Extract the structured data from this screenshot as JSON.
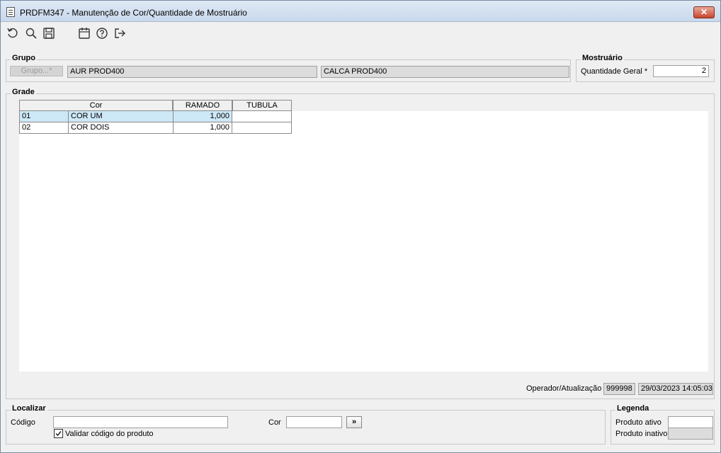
{
  "window": {
    "title": "PRDFM347 - Manutenção de Cor/Quantidade de Mostruário",
    "close_label": "✕"
  },
  "toolbar": {
    "icons": [
      "undo-icon",
      "search-icon",
      "save-icon",
      "calendar-icon",
      "help-icon",
      "exit-icon"
    ]
  },
  "grupo": {
    "legend": "Grupo",
    "button_label": "Grupo...*",
    "field1": "AUR PROD400",
    "field2": "CALCA PROD400"
  },
  "mostruario": {
    "legend": "Mostruário",
    "qty_label": "Quantidade Geral *",
    "qty_value": "2"
  },
  "grade": {
    "legend": "Grade",
    "columns": [
      "Cor",
      "RAMADO",
      "TUBULA"
    ],
    "rows": [
      {
        "code": "01",
        "name": "COR UM",
        "ramado": "1,000",
        "tubula": ""
      },
      {
        "code": "02",
        "name": "COR DOIS",
        "ramado": "1,000",
        "tubula": ""
      }
    ]
  },
  "operador": {
    "label": "Operador/Atualização",
    "user": "999998",
    "timestamp": "29/03/2023 14:05:03"
  },
  "localizar": {
    "legend": "Localizar",
    "codigo_label": "Código",
    "codigo_value": "",
    "cor_label": "Cor",
    "cor_value": "",
    "go_label": "»",
    "validar_label": "Validar código do produto",
    "validar_checked": true
  },
  "legenda": {
    "legend": "Legenda",
    "ativo_label": "Produto ativo",
    "inativo_label": "Produto inativo"
  }
}
